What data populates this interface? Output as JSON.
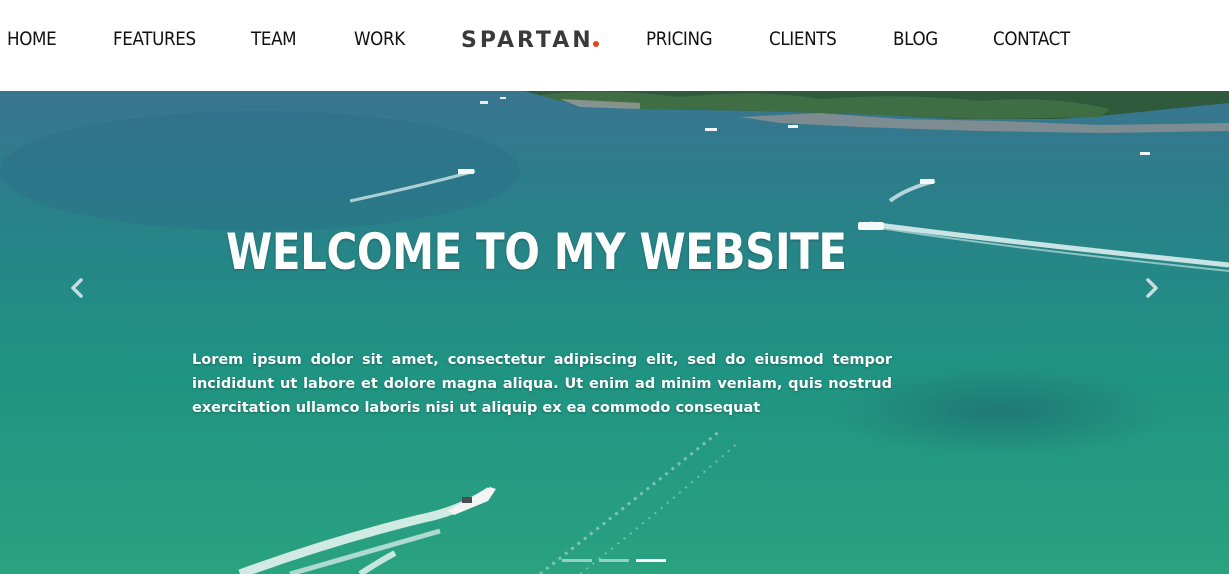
{
  "nav": {
    "left_items": [
      "HOME",
      "FEATURES",
      "TEAM",
      "WORK"
    ],
    "logo": "SPARTAN",
    "right_items": [
      "PRICING",
      "CLIENTS",
      "BLOG",
      "CONTACT"
    ]
  },
  "hero": {
    "title": "WELCOME TO MY WEBSITE",
    "text": "Lorem ipsum dolor sit amet, consectetur adipiscing elit, sed do eiusmod tempor incididunt ut labore et dolore magna aliqua. Ut enim ad minim veniam, quis nostrud exercitation ullamco laboris nisi ut aliquip ex ea commodo consequat",
    "prev_icon": "chevron-left-icon",
    "next_icon": "chevron-right-icon",
    "slide_count": 3,
    "active_slide": 3
  },
  "colors": {
    "logo_dot": "#e8421e",
    "nav_text": "#111111",
    "hero_text": "#ffffff"
  }
}
